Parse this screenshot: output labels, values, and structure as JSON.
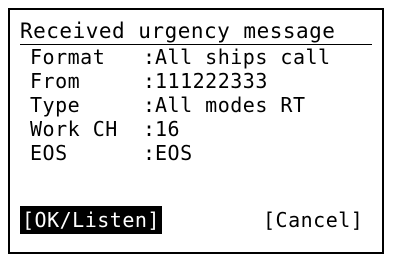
{
  "dialog": {
    "title": "Received urgency message",
    "separator": ":",
    "fields": [
      {
        "label": "Format",
        "value": "All ships call"
      },
      {
        "label": "From",
        "value": "111222333"
      },
      {
        "label": "Type",
        "value": "All modes RT"
      },
      {
        "label": "Work CH",
        "value": "16"
      },
      {
        "label": "EOS",
        "value": "EOS"
      }
    ],
    "ok_label": "[OK/Listen]",
    "cancel_label": "[Cancel]"
  },
  "colors": {
    "background": "#ffffff",
    "foreground": "#000000",
    "selected_background": "#000000",
    "selected_foreground": "#ffffff"
  }
}
